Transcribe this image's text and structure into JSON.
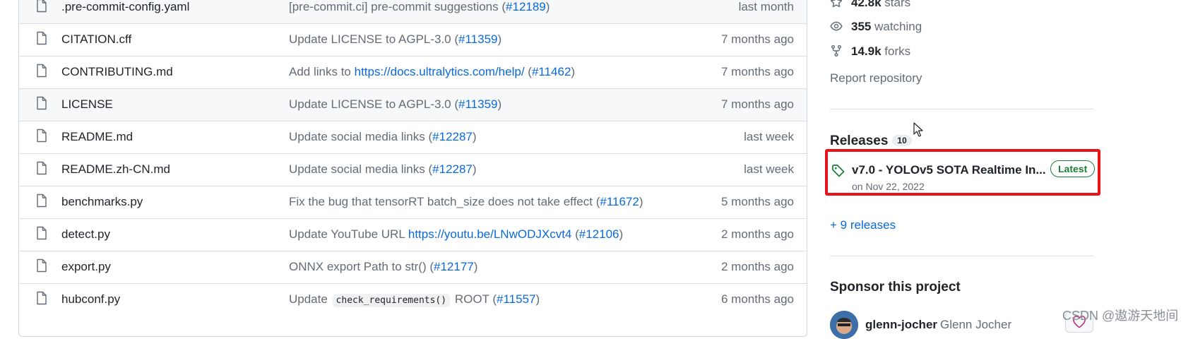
{
  "files": [
    {
      "name": ".pre-commit-config.yaml",
      "msg_pre": "[pre-commit.ci] pre-commit suggestions (",
      "link": "#12189",
      "msg_post": ")",
      "age": "last month"
    },
    {
      "name": "CITATION.cff",
      "msg_pre": "Update LICENSE to AGPL-3.0 (",
      "link": "#11359",
      "msg_post": ")",
      "age": "7 months ago"
    },
    {
      "name": "CONTRIBUTING.md",
      "msg_pre": "Add links to ",
      "url": "https://docs.ultralytics.com/help/",
      "msg_mid": " (",
      "link": "#11462",
      "msg_post": ")",
      "age": "7 months ago"
    },
    {
      "name": "LICENSE",
      "msg_pre": "Update LICENSE to AGPL-3.0 (",
      "link": "#11359",
      "msg_post": ")",
      "age": "7 months ago"
    },
    {
      "name": "README.md",
      "msg_pre": "Update social media links (",
      "link": "#12287",
      "msg_post": ")",
      "age": "last week"
    },
    {
      "name": "README.zh-CN.md",
      "msg_pre": "Update social media links (",
      "link": "#12287",
      "msg_post": ")",
      "age": "last week"
    },
    {
      "name": "benchmarks.py",
      "msg_pre": "Fix the bug that tensorRT batch_size does not take effect (",
      "link": "#11672",
      "msg_post": ")",
      "age": "5 months ago"
    },
    {
      "name": "detect.py",
      "msg_pre": "Update YouTube URL ",
      "url": "https://youtu.be/LNwODJXcvt4",
      "msg_mid": " (",
      "link": "#12106",
      "msg_post": ")",
      "age": "2 months ago"
    },
    {
      "name": "export.py",
      "msg_pre": "ONNX export Path to str() (",
      "link": "#12177",
      "msg_post": ")",
      "age": "2 months ago"
    },
    {
      "name": "hubconf.py",
      "msg_pre": "Update ",
      "code": "check_requirements()",
      "msg_mid": " ROOT (",
      "link": "#11557",
      "msg_post": ")",
      "age": "6 months ago"
    }
  ],
  "sidebar": {
    "stars": {
      "value": "42.8k",
      "label": " stars"
    },
    "watching": {
      "value": "355",
      "label": " watching"
    },
    "forks": {
      "value": "14.9k",
      "label": " forks"
    },
    "report": "Report repository",
    "releases_title": "Releases",
    "releases_count": "10",
    "release_name": "v7.0 - YOLOv5 SOTA Realtime In...",
    "release_badge": "Latest",
    "release_date": "on Nov 22, 2022",
    "more_releases": "+ 9 releases",
    "sponsor_title": "Sponsor this project",
    "sponsor_login": "glenn-jocher",
    "sponsor_name": "Glenn Jocher"
  },
  "watermark": "CSDN @遨游天地间",
  "colors": {
    "accent": "#0969da",
    "highlight": "#e8141c",
    "latest": "#1a7f37"
  }
}
